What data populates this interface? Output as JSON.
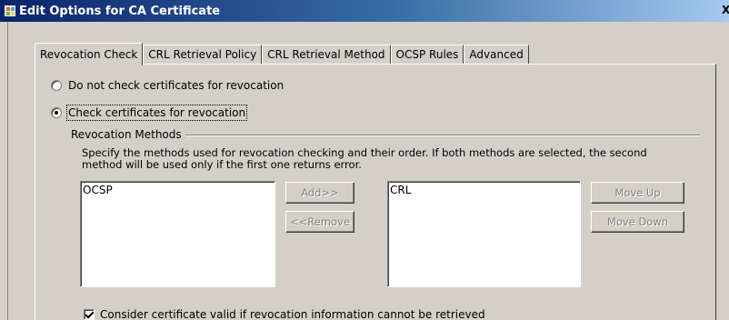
{
  "window": {
    "title": "Edit Options for CA Certificate",
    "close_glyph": "X",
    "icon": "certificate-app-icon"
  },
  "tabs": [
    {
      "label": "Revocation Check",
      "active": true
    },
    {
      "label": "CRL Retrieval Policy",
      "active": false
    },
    {
      "label": "CRL Retrieval Method",
      "active": false
    },
    {
      "label": "OCSP Rules",
      "active": false
    },
    {
      "label": "Advanced",
      "active": false
    }
  ],
  "revocation": {
    "options": [
      {
        "label": "Do not check certificates for revocation",
        "selected": false
      },
      {
        "label": "Check certificates for revocation",
        "selected": true
      }
    ],
    "methods_group": {
      "title": "Revocation Methods",
      "description": "Specify the methods used for revocation checking and their order. If both methods are selected, the second method will be used only if the first one returns error."
    },
    "available_list": [
      "OCSP"
    ],
    "selected_list": [
      "CRL"
    ],
    "buttons": {
      "add": "Add>>",
      "remove": "<<Remove",
      "move_up": "Move Up",
      "move_down": "Move Down"
    },
    "consider_valid": {
      "label": "Consider certificate valid if revocation information cannot be retrieved",
      "checked": true
    }
  }
}
